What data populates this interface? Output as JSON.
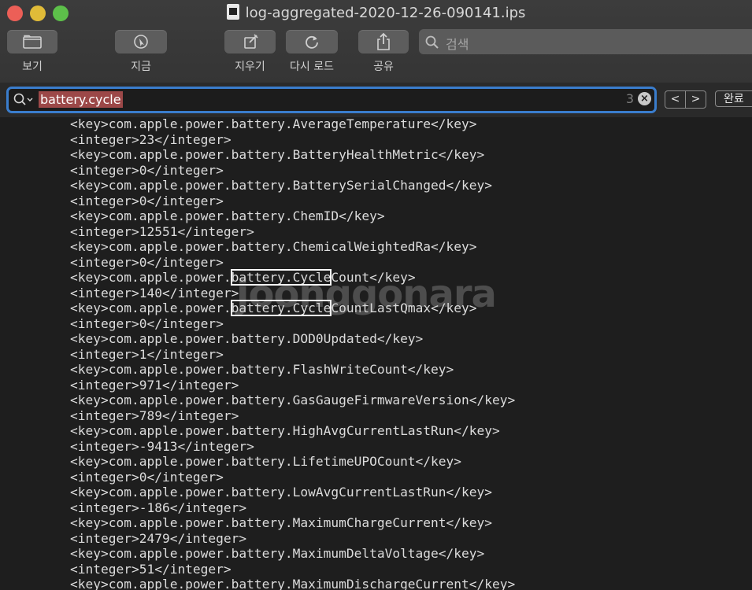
{
  "window": {
    "title": "log-aggregated-2020-12-26-090141.ips"
  },
  "toolbar": {
    "view_label": "보기",
    "now_label": "지금",
    "clear_label": "지우기",
    "reload_label": "다시 로드",
    "share_label": "공유",
    "search_placeholder": "검색"
  },
  "find": {
    "query": "battery.cycle",
    "match_count": "3",
    "clear_icon": "ⓧ",
    "prev": "<",
    "next": ">",
    "done_label": "완료"
  },
  "log_lines": [
    "<key>com.apple.power.battery.AverageTemperature</key>",
    "<integer>23</integer>",
    "<key>com.apple.power.battery.BatteryHealthMetric</key>",
    "<integer>0</integer>",
    "<key>com.apple.power.battery.BatterySerialChanged</key>",
    "<integer>0</integer>",
    "<key>com.apple.power.battery.ChemID</key>",
    "<integer>12551</integer>",
    "<key>com.apple.power.battery.ChemicalWeightedRa</key>",
    "<integer>0</integer>",
    {
      "pre": "<key>com.apple.power.",
      "match": "battery.Cycle",
      "post": "Count</key>"
    },
    "<integer>140</integer>",
    {
      "pre": "<key>com.apple.power.",
      "match": "battery.Cycle",
      "post": "CountLastQmax</key>"
    },
    "<integer>0</integer>",
    "<key>com.apple.power.battery.DOD0Updated</key>",
    "<integer>1</integer>",
    "<key>com.apple.power.battery.FlashWriteCount</key>",
    "<integer>971</integer>",
    "<key>com.apple.power.battery.GasGaugeFirmwareVersion</key>",
    "<integer>789</integer>",
    "<key>com.apple.power.battery.HighAvgCurrentLastRun</key>",
    "<integer>-9413</integer>",
    "<key>com.apple.power.battery.LifetimeUPOCount</key>",
    "<integer>0</integer>",
    "<key>com.apple.power.battery.LowAvgCurrentLastRun</key>",
    "<integer>-186</integer>",
    "<key>com.apple.power.battery.MaximumChargeCurrent</key>",
    "<integer>2479</integer>",
    "<key>com.apple.power.battery.MaximumDeltaVoltage</key>",
    "<integer>51</integer>",
    "<key>com.apple.power.battery.MaximumDischargeCurrent</key>"
  ],
  "watermark": "joonggonara"
}
